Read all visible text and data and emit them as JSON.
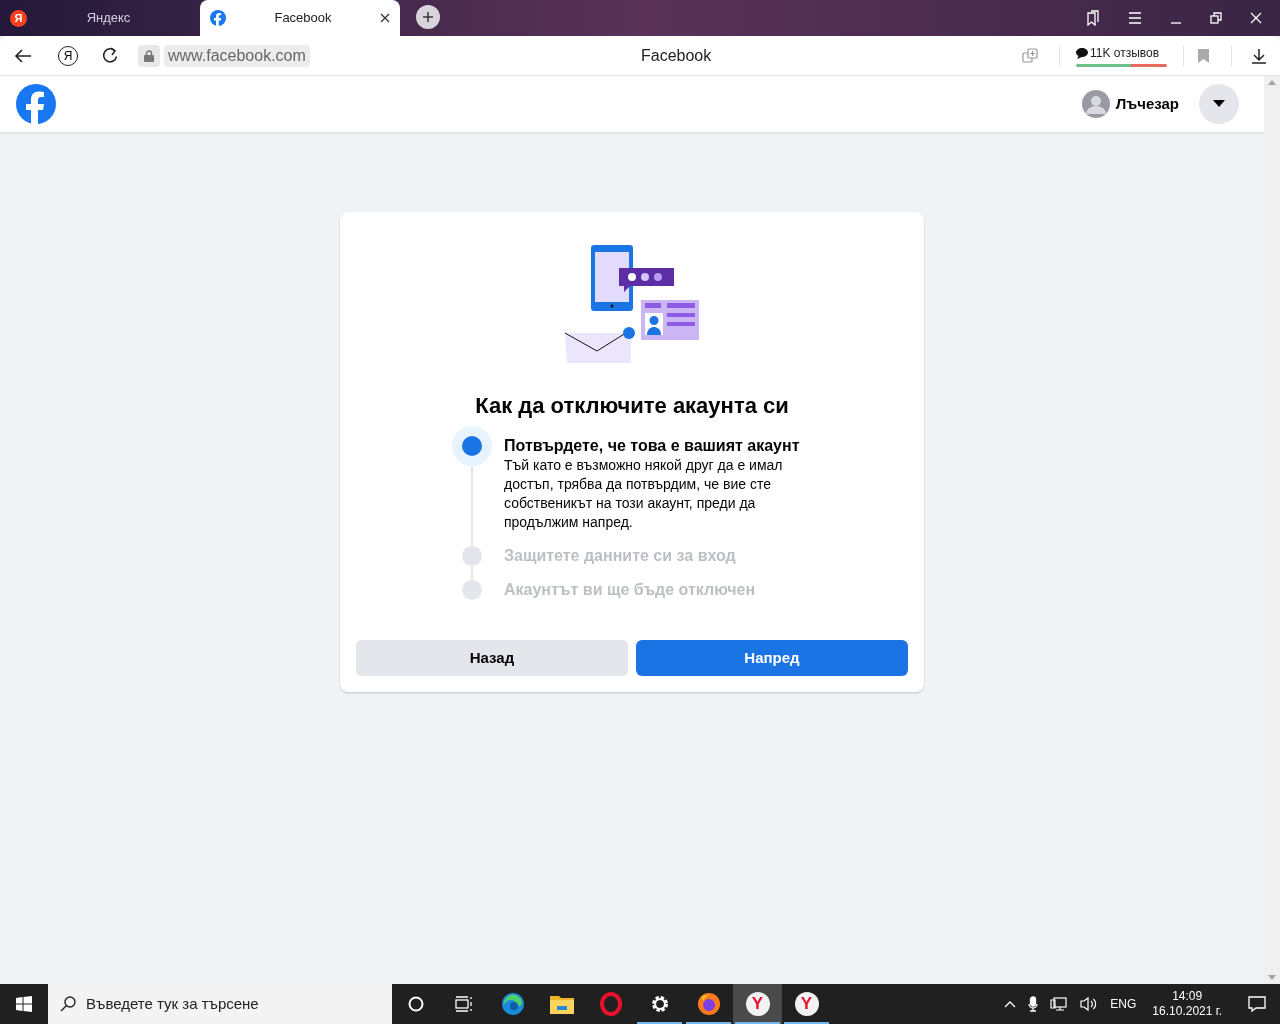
{
  "browser": {
    "tabs": [
      {
        "label": "Яндекс",
        "kind": "yandex",
        "glyph": "Я",
        "selected": false
      },
      {
        "label": "Facebook",
        "kind": "facebook",
        "selected": true
      }
    ],
    "home_glyph": "Я",
    "url": "www.facebook.com",
    "page_title": "Facebook",
    "reviews": "11K отзывов"
  },
  "header": {
    "user_name": "Лъчезар"
  },
  "card": {
    "title": "Как да отключите акаунта си",
    "steps": [
      {
        "title": "Потвърдете, че това е вашият акаунт",
        "description": "Тъй като е възможно някой друг да е имал достъп, трябва да потвърдим, че вие сте собственикът на този акаунт, преди да продължим напред.",
        "active": true
      },
      {
        "title": "Защитете данните си за вход",
        "active": false
      },
      {
        "title": "Акаунтът ви ще бъде отключен",
        "active": false
      }
    ],
    "buttons": [
      {
        "label": "Назад",
        "kind": "secondary"
      },
      {
        "label": "Напред",
        "kind": "primary"
      }
    ]
  },
  "taskbar": {
    "search_placeholder": "Въведете тук за търсене",
    "apps": [
      {
        "kind": "edge",
        "running": false,
        "selected": false
      },
      {
        "kind": "explorer",
        "running": false,
        "selected": false
      },
      {
        "kind": "opera",
        "running": false,
        "selected": false
      },
      {
        "kind": "settings",
        "running": true,
        "selected": false
      },
      {
        "kind": "firefox",
        "running": true,
        "selected": false
      },
      {
        "kind": "yandex",
        "glyph": "Y",
        "running": true,
        "selected": true
      },
      {
        "kind": "yandex",
        "glyph": "Y",
        "running": true,
        "selected": false
      }
    ],
    "language": "ENG",
    "time": "14:09",
    "date": "16.10.2021 г."
  }
}
